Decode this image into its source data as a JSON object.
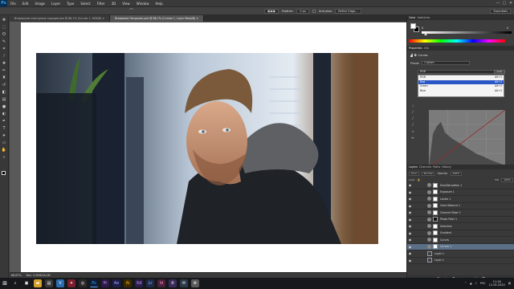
{
  "app": {
    "logo": "Ps"
  },
  "menu": [
    "File",
    "Edit",
    "Image",
    "Layer",
    "Type",
    "Select",
    "Filter",
    "3D",
    "View",
    "Window",
    "Help"
  ],
  "window_controls": [
    "—",
    "▢",
    "✕"
  ],
  "options": {
    "feather_label": "Feather:",
    "feather_value": "0 px",
    "antialias_label": "Anti-alias",
    "refine_edge": "Refine Edge...",
    "workspace": "Essentials"
  },
  "tabs": [
    {
      "label": "Вчерашние контурные городов.psd @ 66,7% (Curves 1, RGB/8) ×",
      "active": false
    },
    {
      "label": "Внимание Потрачен.psd @ 66,7% (Curves 1, Layer Mask/8) ×",
      "active": true
    }
  ],
  "status": {
    "zoom": "66,67%",
    "doc": "Doc: 2,90M/16,4M"
  },
  "color_panel": {
    "tabs": [
      "Color",
      "Swatches"
    ],
    "k_value": "0",
    "k_label": "K"
  },
  "properties": {
    "tabs": [
      "Properties",
      "Info"
    ],
    "adjustment": "Curves",
    "preset_label": "Preset:",
    "preset_value": "Custom",
    "channel_current": "RGB",
    "auto_label": "Auto",
    "channels": [
      {
        "name": "RGB",
        "shortcut": "Alt+2",
        "selected": false
      },
      {
        "name": "Red",
        "shortcut": "Alt+3",
        "selected": true
      },
      {
        "name": "Green",
        "shortcut": "Alt+4",
        "selected": false
      },
      {
        "name": "Blue",
        "shortcut": "Alt+5",
        "selected": false
      }
    ]
  },
  "layers_panel": {
    "tabs": [
      "Layers",
      "Channels",
      "Paths",
      "History"
    ],
    "filter_label": "Kind",
    "blend_mode": "Normal",
    "opacity_label": "Opacity:",
    "opacity_value": "100%",
    "lock_label": "Lock:",
    "fill_label": "Fill:",
    "fill_value": "100%",
    "layers": [
      {
        "name": "Hue/Saturation 1",
        "type": "adj",
        "active": false
      },
      {
        "name": "Exposure 1",
        "type": "adj",
        "active": false
      },
      {
        "name": "Levels 1",
        "type": "adj",
        "active": false
      },
      {
        "name": "Color Balance 1",
        "type": "adj",
        "active": false
      },
      {
        "name": "Channel Mixer 1",
        "type": "adj",
        "active": false
      },
      {
        "name": "Photo Filter 1",
        "type": "adj",
        "active": false
      },
      {
        "name": "Selective",
        "type": "adj",
        "active": false
      },
      {
        "name": "Gradient",
        "type": "adj",
        "active": false
      },
      {
        "name": "Curves",
        "type": "adj",
        "active": false
      },
      {
        "name": "Curves 1",
        "type": "adj",
        "active": true
      },
      {
        "name": "Layer 1",
        "type": "img",
        "active": false
      },
      {
        "name": "Layer 1",
        "type": "img",
        "active": false
      }
    ],
    "footer_icons": [
      "link-icon",
      "fx-icon",
      "mask-icon",
      "adjustment-icon",
      "folder-icon",
      "new-layer-icon",
      "trash-icon"
    ]
  },
  "taskbar": {
    "start": "⊞",
    "time": "11:18",
    "date": "12.05.2020",
    "lang": "РУС"
  },
  "colors": {
    "accent": "#2a56c6",
    "active_layer": "#5b6f87",
    "canvas_bg": "#595959"
  }
}
